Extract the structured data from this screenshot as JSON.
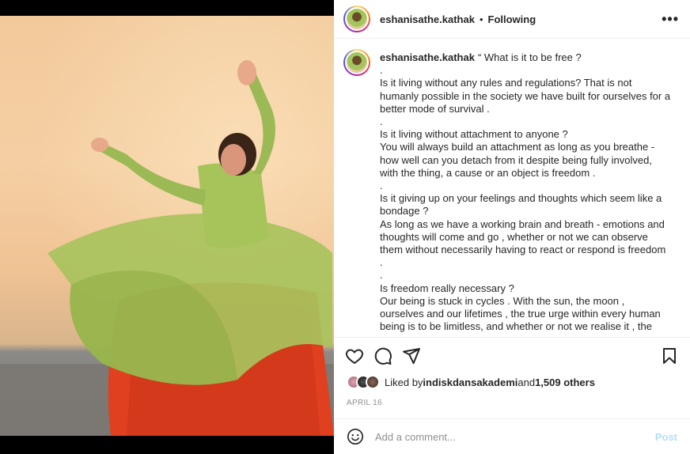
{
  "post": {
    "username": "eshanisathe.kathak",
    "separator": "•",
    "follow_status": "Following",
    "more_label": "•••"
  },
  "caption": {
    "username": "eshanisathe.kathak",
    "text": "“ What is it to be free ?\n.\nIs it living without any rules and regulations? That is not humanly possible in the society we have built for ourselves for a better mode of survival .\n.\nIs it living without attachment to anyone ?\nYou will always build an attachment as long as you breathe - how well can you detach from it despite being fully involved, with the thing, a cause or an object is freedom .\n.\nIs it giving up on your feelings and thoughts which seem like a bondage ?\nAs long as we have a working brain and breath - emotions and thoughts will come and go , whether or not we can observe them without necessarily having to react or respond is freedom .\n.\nIs freedom really necessary ?\nOur being is stuck in cycles . With the sun, the moon , ourselves and our lifetimes , the true urge within every human being is to be limitless, and whether or not we realise it , the"
  },
  "actions": {
    "like_icon": "heart-icon",
    "comment_icon": "comment-icon",
    "share_icon": "paper-plane-icon",
    "save_icon": "bookmark-icon"
  },
  "likes": {
    "prefix": "Liked by ",
    "user": "indiskdansakademi",
    "and": " and ",
    "others": "1,509 others"
  },
  "date": "April 16",
  "comment_box": {
    "placeholder": "Add a comment...",
    "post_label": "Post",
    "emoji_icon": "smiley-icon"
  },
  "colors": {
    "accent_disabled": "#b2dffc",
    "text": "#262626",
    "muted": "#8e8e8e"
  }
}
